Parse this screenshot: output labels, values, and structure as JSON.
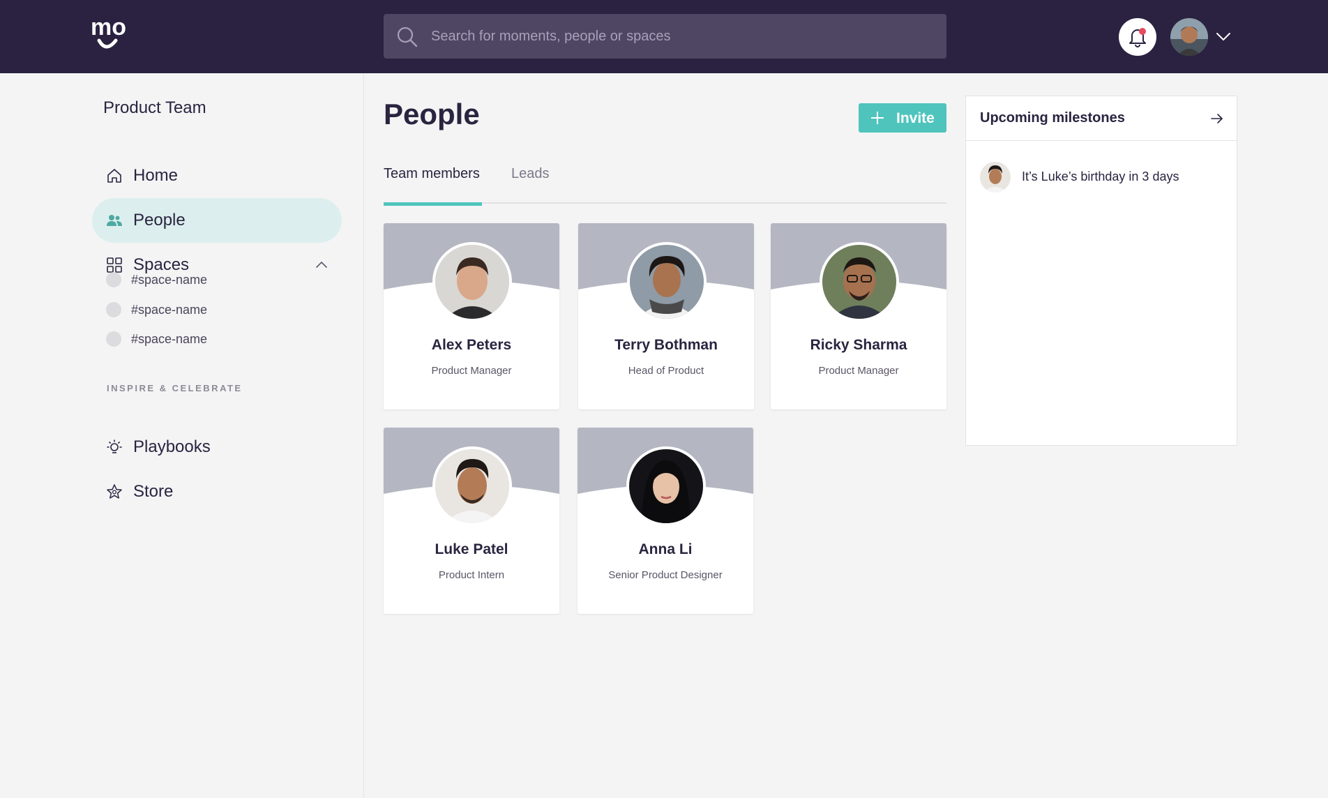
{
  "app": {
    "logo_text": "mo",
    "search_placeholder": "Search for moments, people or spaces"
  },
  "colors": {
    "topbar": "#2a2240",
    "accent": "#4ec4bd",
    "active_nav_bg": "#dcefee",
    "card_banner": "#b4b7c2"
  },
  "sidebar": {
    "team_name": "Product Team",
    "items": [
      {
        "label": "Home",
        "icon": "home-icon"
      },
      {
        "label": "People",
        "icon": "people-icon",
        "active": true
      },
      {
        "label": "Spaces",
        "icon": "grid-icon",
        "expanded": true
      }
    ],
    "spaces": [
      "#space-name",
      "#space-name",
      "#space-name"
    ],
    "section_label": "INSPIRE & CELEBRATE",
    "secondary_items": [
      {
        "label": "Playbooks",
        "icon": "lightbulb-icon"
      },
      {
        "label": "Store",
        "icon": "star-icon"
      }
    ]
  },
  "main": {
    "title": "People",
    "invite_label": "Invite",
    "tabs": [
      {
        "label": "Team members",
        "active": true
      },
      {
        "label": "Leads",
        "active": false
      }
    ],
    "people": [
      {
        "name": "Alex Peters",
        "role": "Product Manager"
      },
      {
        "name": "Terry Bothman",
        "role": "Head of Product"
      },
      {
        "name": "Ricky Sharma",
        "role": "Product Manager"
      },
      {
        "name": "Luke Patel",
        "role": "Product Intern"
      },
      {
        "name": "Anna Li",
        "role": "Senior Product Designer"
      }
    ]
  },
  "milestones": {
    "title": "Upcoming milestones",
    "items": [
      {
        "text": "It’s Luke’s birthday in 3 days"
      }
    ]
  }
}
